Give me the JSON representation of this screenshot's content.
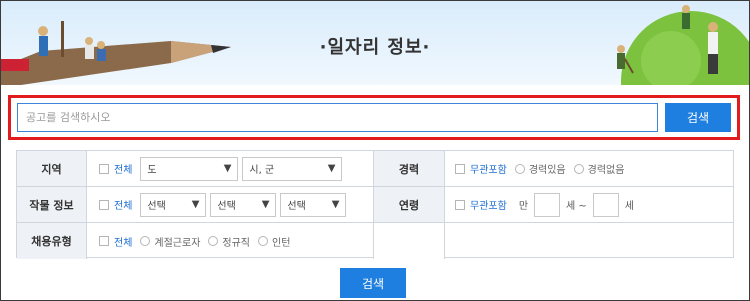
{
  "banner": {
    "title": "·일자리 정보·"
  },
  "search": {
    "placeholder": "공고를 검색하시오",
    "button": "검색"
  },
  "filters": {
    "region": {
      "label": "지역",
      "all": "전체",
      "province": "도",
      "city": "시, 군"
    },
    "crop": {
      "label": "작물 정보",
      "all": "전체",
      "select1": "선택",
      "select2": "선택",
      "select3": "선택"
    },
    "employment": {
      "label": "채용유형",
      "all": "전체",
      "options": [
        "계절근로자",
        "정규직",
        "인턴"
      ]
    },
    "career": {
      "label": "경력",
      "any": "무관포함",
      "options": [
        "경력있음",
        "경력없음"
      ]
    },
    "age": {
      "label": "연령",
      "any": "무관포함",
      "prefix": "만",
      "from_unit": "세 ~",
      "to_unit": "세"
    }
  },
  "footer": {
    "search_button": "검색"
  },
  "colors": {
    "accent": "#1f7fe0",
    "highlight": "#e21c1c",
    "label_bg": "#eef1f5"
  }
}
